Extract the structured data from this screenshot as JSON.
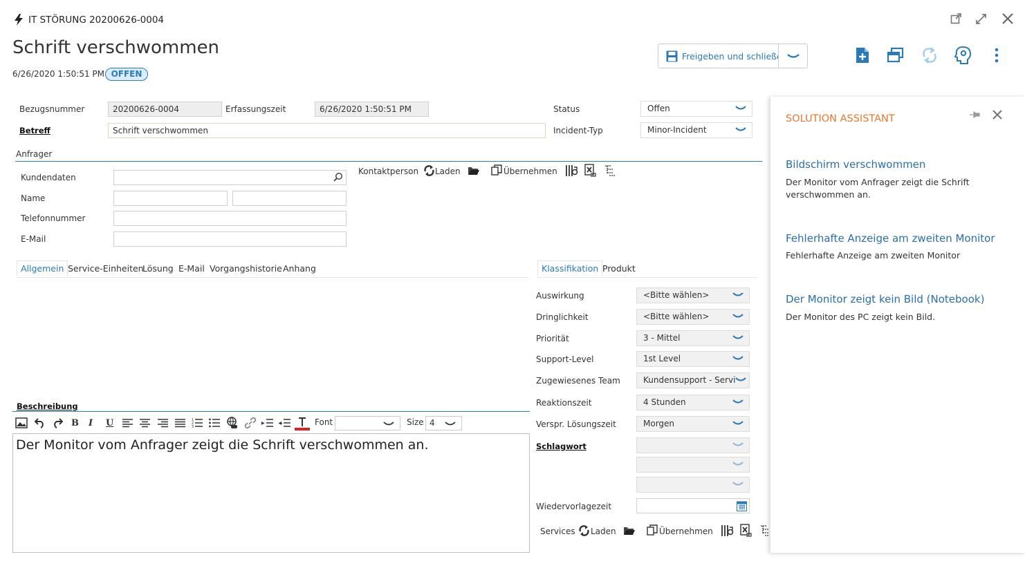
{
  "window": {
    "record_title": "IT STÖRUNG 20200626-0004",
    "heading": "Schrift verschwommen",
    "timestamp": "6/26/2020 1:50:51 PM",
    "status_badge": "OFFEN",
    "save_button": "Freigeben und schließen"
  },
  "form": {
    "bezugsnummer_label": "Bezugsnummer",
    "bezugsnummer_value": "20200626-0004",
    "erfassungszeit_label": "Erfassungszeit",
    "erfassungszeit_value": "6/26/2020 1:50:51 PM",
    "betreff_label": "Betreff",
    "betreff_value": "Schrift verschwommen",
    "status_label": "Status",
    "status_value": "Offen",
    "incident_typ_label": "Incident-Typ",
    "incident_typ_value": "Minor-Incident"
  },
  "anfrager": {
    "section_title": "Anfrager",
    "kundendaten_label": "Kundendaten",
    "name_label": "Name",
    "telefon_label": "Telefonnummer",
    "email_label": "E-Mail",
    "kontaktperson_label": "Kontaktperson",
    "laden_label": "Laden",
    "uebernehmen_label": "Übernehmen"
  },
  "tabs_left": [
    "Allgemein",
    "Service-Einheiten",
    "Lösung",
    "E-Mail",
    "Vorgangshistorie",
    "Anhang"
  ],
  "tabs_right": [
    "Klassifikation",
    "Produkt"
  ],
  "beschreibung": {
    "label": "Beschreibung",
    "font_label": "Font",
    "size_label": "Size",
    "size_value": "4",
    "text": "Der Monitor vom Anfrager zeigt die Schrift verschwommen an."
  },
  "klassifikation": {
    "auswirkung_label": "Auswirkung",
    "auswirkung_value": "<Bitte wählen>",
    "dringlichkeit_label": "Dringlichkeit",
    "dringlichkeit_value": "<Bitte wählen>",
    "prioritaet_label": "Priorität",
    "prioritaet_value": "3 - Mittel",
    "support_level_label": "Support-Level",
    "support_level_value": "1st Level",
    "team_label": "Zugewiesenes Team",
    "team_value": "Kundensupport - Servi",
    "reaktionszeit_label": "Reaktionszeit",
    "reaktionszeit_value": "4 Stunden",
    "loesungszeit_label": "Verspr. Lösungszeit",
    "loesungszeit_value": "Morgen",
    "schlagwort_label": "Schlagwort",
    "wiedervorlage_label": "Wiedervorlagezeit",
    "services_label": "Services",
    "laden_label": "Laden",
    "uebernehmen_label": "Übernehmen"
  },
  "solution_assistant": {
    "title": "SOLUTION ASSISTANT",
    "items": [
      {
        "title": "Bildschirm verschwommen",
        "text": "Der Monitor vom Anfrager zeigt die Schrift verschwommen an."
      },
      {
        "title": "Fehlerhafte Anzeige am zweiten Monitor",
        "text": "Fehlerhafte Anzeige am zweiten Monitor"
      },
      {
        "title": "Der Monitor zeigt kein Bild (Notebook)",
        "text": "Der Monitor des PC zeigt kein Bild."
      }
    ]
  },
  "colors": {
    "accent": "#2a7ab8",
    "badge_bg": "#d9ecf7",
    "solution_title": "#e8772e",
    "link": "#2a6fa9"
  }
}
